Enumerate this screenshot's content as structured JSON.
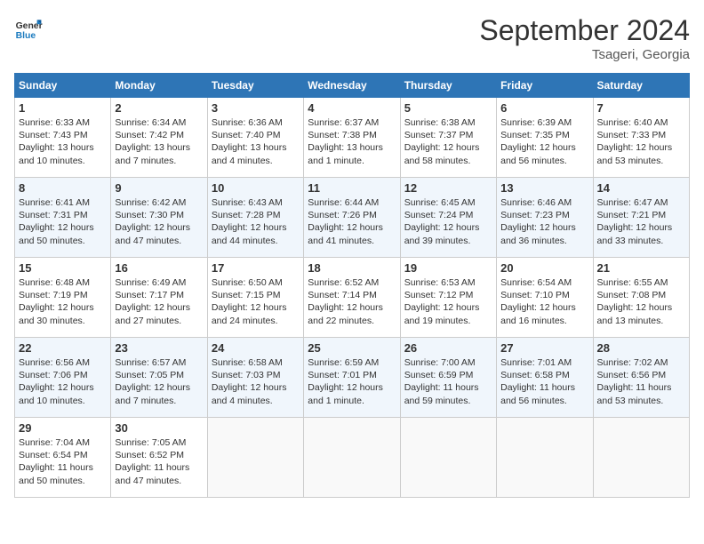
{
  "header": {
    "logo_line1": "General",
    "logo_line2": "Blue",
    "month": "September 2024",
    "location": "Tsageri, Georgia"
  },
  "days_of_week": [
    "Sunday",
    "Monday",
    "Tuesday",
    "Wednesday",
    "Thursday",
    "Friday",
    "Saturday"
  ],
  "weeks": [
    [
      {
        "day": "1",
        "sunrise": "6:33 AM",
        "sunset": "7:43 PM",
        "daylight": "13 hours and 10 minutes."
      },
      {
        "day": "2",
        "sunrise": "6:34 AM",
        "sunset": "7:42 PM",
        "daylight": "13 hours and 7 minutes."
      },
      {
        "day": "3",
        "sunrise": "6:36 AM",
        "sunset": "7:40 PM",
        "daylight": "13 hours and 4 minutes."
      },
      {
        "day": "4",
        "sunrise": "6:37 AM",
        "sunset": "7:38 PM",
        "daylight": "13 hours and 1 minute."
      },
      {
        "day": "5",
        "sunrise": "6:38 AM",
        "sunset": "7:37 PM",
        "daylight": "12 hours and 58 minutes."
      },
      {
        "day": "6",
        "sunrise": "6:39 AM",
        "sunset": "7:35 PM",
        "daylight": "12 hours and 56 minutes."
      },
      {
        "day": "7",
        "sunrise": "6:40 AM",
        "sunset": "7:33 PM",
        "daylight": "12 hours and 53 minutes."
      }
    ],
    [
      {
        "day": "8",
        "sunrise": "6:41 AM",
        "sunset": "7:31 PM",
        "daylight": "12 hours and 50 minutes."
      },
      {
        "day": "9",
        "sunrise": "6:42 AM",
        "sunset": "7:30 PM",
        "daylight": "12 hours and 47 minutes."
      },
      {
        "day": "10",
        "sunrise": "6:43 AM",
        "sunset": "7:28 PM",
        "daylight": "12 hours and 44 minutes."
      },
      {
        "day": "11",
        "sunrise": "6:44 AM",
        "sunset": "7:26 PM",
        "daylight": "12 hours and 41 minutes."
      },
      {
        "day": "12",
        "sunrise": "6:45 AM",
        "sunset": "7:24 PM",
        "daylight": "12 hours and 39 minutes."
      },
      {
        "day": "13",
        "sunrise": "6:46 AM",
        "sunset": "7:23 PM",
        "daylight": "12 hours and 36 minutes."
      },
      {
        "day": "14",
        "sunrise": "6:47 AM",
        "sunset": "7:21 PM",
        "daylight": "12 hours and 33 minutes."
      }
    ],
    [
      {
        "day": "15",
        "sunrise": "6:48 AM",
        "sunset": "7:19 PM",
        "daylight": "12 hours and 30 minutes."
      },
      {
        "day": "16",
        "sunrise": "6:49 AM",
        "sunset": "7:17 PM",
        "daylight": "12 hours and 27 minutes."
      },
      {
        "day": "17",
        "sunrise": "6:50 AM",
        "sunset": "7:15 PM",
        "daylight": "12 hours and 24 minutes."
      },
      {
        "day": "18",
        "sunrise": "6:52 AM",
        "sunset": "7:14 PM",
        "daylight": "12 hours and 22 minutes."
      },
      {
        "day": "19",
        "sunrise": "6:53 AM",
        "sunset": "7:12 PM",
        "daylight": "12 hours and 19 minutes."
      },
      {
        "day": "20",
        "sunrise": "6:54 AM",
        "sunset": "7:10 PM",
        "daylight": "12 hours and 16 minutes."
      },
      {
        "day": "21",
        "sunrise": "6:55 AM",
        "sunset": "7:08 PM",
        "daylight": "12 hours and 13 minutes."
      }
    ],
    [
      {
        "day": "22",
        "sunrise": "6:56 AM",
        "sunset": "7:06 PM",
        "daylight": "12 hours and 10 minutes."
      },
      {
        "day": "23",
        "sunrise": "6:57 AM",
        "sunset": "7:05 PM",
        "daylight": "12 hours and 7 minutes."
      },
      {
        "day": "24",
        "sunrise": "6:58 AM",
        "sunset": "7:03 PM",
        "daylight": "12 hours and 4 minutes."
      },
      {
        "day": "25",
        "sunrise": "6:59 AM",
        "sunset": "7:01 PM",
        "daylight": "12 hours and 1 minute."
      },
      {
        "day": "26",
        "sunrise": "7:00 AM",
        "sunset": "6:59 PM",
        "daylight": "11 hours and 59 minutes."
      },
      {
        "day": "27",
        "sunrise": "7:01 AM",
        "sunset": "6:58 PM",
        "daylight": "11 hours and 56 minutes."
      },
      {
        "day": "28",
        "sunrise": "7:02 AM",
        "sunset": "6:56 PM",
        "daylight": "11 hours and 53 minutes."
      }
    ],
    [
      {
        "day": "29",
        "sunrise": "7:04 AM",
        "sunset": "6:54 PM",
        "daylight": "11 hours and 50 minutes."
      },
      {
        "day": "30",
        "sunrise": "7:05 AM",
        "sunset": "6:52 PM",
        "daylight": "11 hours and 47 minutes."
      },
      null,
      null,
      null,
      null,
      null
    ]
  ]
}
